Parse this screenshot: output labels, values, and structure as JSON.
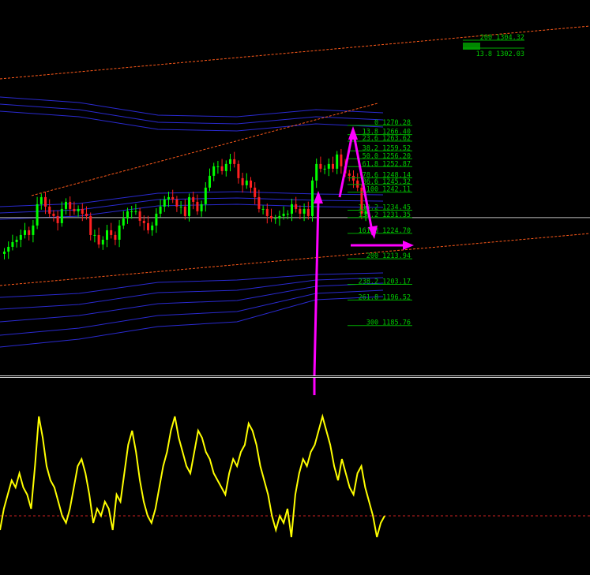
{
  "colors": {
    "background": "#000000",
    "bull_candle": "#00ff00",
    "bear_candle": "#ff2020",
    "envelope": "#2a2ad0",
    "channel": "#ff5a1a",
    "fib": "#00b000",
    "highlight_box": "#008800",
    "annotation": "#ff00ff",
    "oscillator": "#ffff00",
    "oscillator_level": "#cc2222",
    "price_line": "#c0c0c0"
  },
  "chart_data": [
    {
      "type": "candlestick",
      "title": "",
      "xlabel": "",
      "ylabel": "",
      "grid": false,
      "ylim": [
        1180,
        1320
      ],
      "closes": [
        1217,
        1219,
        1221,
        1222,
        1224,
        1226,
        1224,
        1228,
        1237,
        1240,
        1236,
        1233,
        1232,
        1229,
        1235,
        1238,
        1235,
        1234,
        1235,
        1233,
        1232,
        1224,
        1224,
        1220,
        1222,
        1226,
        1224,
        1222,
        1228,
        1231,
        1234,
        1234,
        1234,
        1230,
        1229,
        1226,
        1228,
        1233,
        1236,
        1239,
        1240,
        1239,
        1236,
        1236,
        1232,
        1240,
        1238,
        1234,
        1237,
        1244,
        1249,
        1253,
        1253,
        1251,
        1254,
        1256,
        1254,
        1248,
        1245,
        1247,
        1244,
        1240,
        1235,
        1235,
        1232,
        1231,
        1231,
        1232,
        1233,
        1233,
        1237,
        1235,
        1233,
        1235,
        1232,
        1247,
        1254,
        1252,
        1252,
        1254,
        1252,
        1258,
        1253,
        1250,
        1249,
        1247,
        1244,
        1233,
        1234
      ],
      "fib_levels": [
        {
          "label": "0 1270.28",
          "value": 1270.28
        },
        {
          "label": "13.8 1266.40",
          "value": 1266.4
        },
        {
          "label": "23.6 1263.62",
          "value": 1263.62
        },
        {
          "label": "38.2 1259.52",
          "value": 1259.52
        },
        {
          "label": "50.0 1256.20",
          "value": 1256.2
        },
        {
          "label": "61.8 1252.87",
          "value": 1252.87
        },
        {
          "label": "78.6 1248.14",
          "value": 1248.14
        },
        {
          "label": "86.6 1245.32",
          "value": 1245.32
        },
        {
          "label": "100 1242.11",
          "value": 1242.11
        },
        {
          "label": "113.2 1234.45",
          "value": 1234.45
        },
        {
          "label": "138.2 1231.35",
          "value": 1231.35
        },
        {
          "label": "161.8 1224.70",
          "value": 1224.7
        },
        {
          "label": "200 1213.94",
          "value": 1213.94
        },
        {
          "label": "238.2 1203.17",
          "value": 1203.17
        },
        {
          "label": "261.8 1196.52",
          "value": 1196.52
        },
        {
          "label": "300 1185.76",
          "value": 1185.76
        }
      ],
      "upper_fib_levels": [
        {
          "label": "200 1304.32",
          "value": 1304.32
        },
        {
          "label": "13.8 1302.03",
          "value": 1302.03
        }
      ],
      "current_price": 1231.35
    },
    {
      "type": "line",
      "title": "",
      "xlabel": "",
      "ylabel": "",
      "grid": false,
      "ylim": [
        0,
        100
      ],
      "level": 20,
      "series": [
        {
          "values": [
            15,
            30,
            40,
            50,
            45,
            55,
            45,
            40,
            30,
            60,
            95,
            80,
            60,
            50,
            45,
            35,
            25,
            20,
            30,
            45,
            60,
            65,
            55,
            40,
            20,
            30,
            25,
            35,
            30,
            15,
            40,
            35,
            55,
            75,
            85,
            70,
            50,
            35,
            25,
            20,
            30,
            45,
            60,
            70,
            85,
            95,
            80,
            70,
            60,
            55,
            70,
            85,
            80,
            70,
            65,
            55,
            50,
            45,
            40,
            55,
            65,
            60,
            70,
            75,
            90,
            85,
            75,
            60,
            50,
            40,
            25,
            15,
            25,
            20,
            30,
            10,
            40,
            55,
            65,
            60,
            70,
            75,
            85,
            95,
            85,
            75,
            60,
            50,
            65,
            55,
            45,
            40,
            55,
            60,
            45,
            35,
            25,
            10,
            20,
            25
          ]
        }
      ]
    }
  ]
}
